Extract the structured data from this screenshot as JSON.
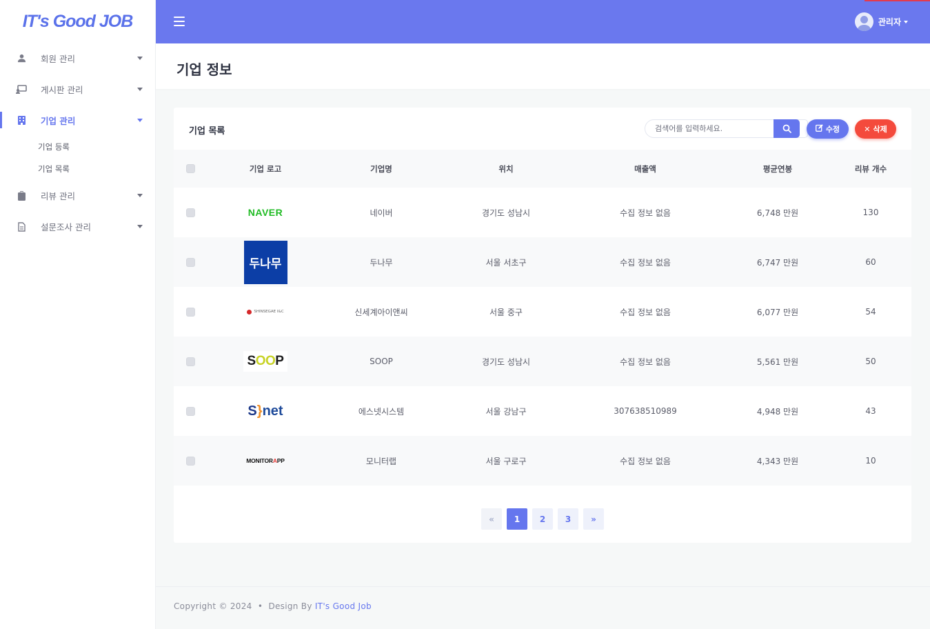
{
  "brand": {
    "logo_text": "IT's Good JOB"
  },
  "sidebar": {
    "items": [
      {
        "label": "회원 관리",
        "icon": "user-icon"
      },
      {
        "label": "게시판 관리",
        "icon": "board-icon"
      },
      {
        "label": "기업 관리",
        "icon": "building-icon",
        "active": true,
        "children": [
          "기업 등록",
          "기업 목록"
        ]
      },
      {
        "label": "리뷰 관리",
        "icon": "clipboard-icon"
      },
      {
        "label": "설문조사 관리",
        "icon": "document-icon"
      }
    ]
  },
  "topbar": {
    "user_name": "관리자",
    "accent": "#6a78ee"
  },
  "page": {
    "title": "기업 정보"
  },
  "card": {
    "title": "기업 목록",
    "search_placeholder": "검색어를 입력하세요.",
    "edit_label": "수정",
    "delete_label": "삭제"
  },
  "table": {
    "headers": [
      "기업 로고",
      "기업명",
      "위치",
      "매출액",
      "평균연봉",
      "리뷰 개수"
    ],
    "rows": [
      {
        "logo": "NAVER",
        "name": "네이버",
        "location": "경기도 성남시",
        "sales": "수집 정보 없음",
        "salary": "6,748 만원",
        "reviews": "130"
      },
      {
        "logo": "두나무",
        "name": "두나무",
        "location": "서울 서초구",
        "sales": "수집 정보 없음",
        "salary": "6,747 만원",
        "reviews": "60"
      },
      {
        "logo": "SHINSEGAE I&C",
        "name": "신세계아이앤씨",
        "location": "서울 중구",
        "sales": "수집 정보 없음",
        "salary": "6,077 만원",
        "reviews": "54"
      },
      {
        "logo": "SOOP",
        "name": "SOOP",
        "location": "경기도 성남시",
        "sales": "수집 정보 없음",
        "salary": "5,561 만원",
        "reviews": "50"
      },
      {
        "logo": "S}net",
        "name": "에스넷시스템",
        "location": "서울 강남구",
        "sales": "307638510989",
        "salary": "4,948 만원",
        "reviews": "43"
      },
      {
        "logo": "MONITORAPP",
        "name": "모니터랩",
        "location": "서울 구로구",
        "sales": "수집 정보 없음",
        "salary": "4,343 만원",
        "reviews": "10"
      }
    ]
  },
  "pagination": {
    "prev": "«",
    "pages": [
      "1",
      "2",
      "3"
    ],
    "next": "»",
    "current": "1"
  },
  "footer": {
    "copyright": "Copyright © 2024  •  Design By ",
    "link": "IT's Good Job"
  }
}
